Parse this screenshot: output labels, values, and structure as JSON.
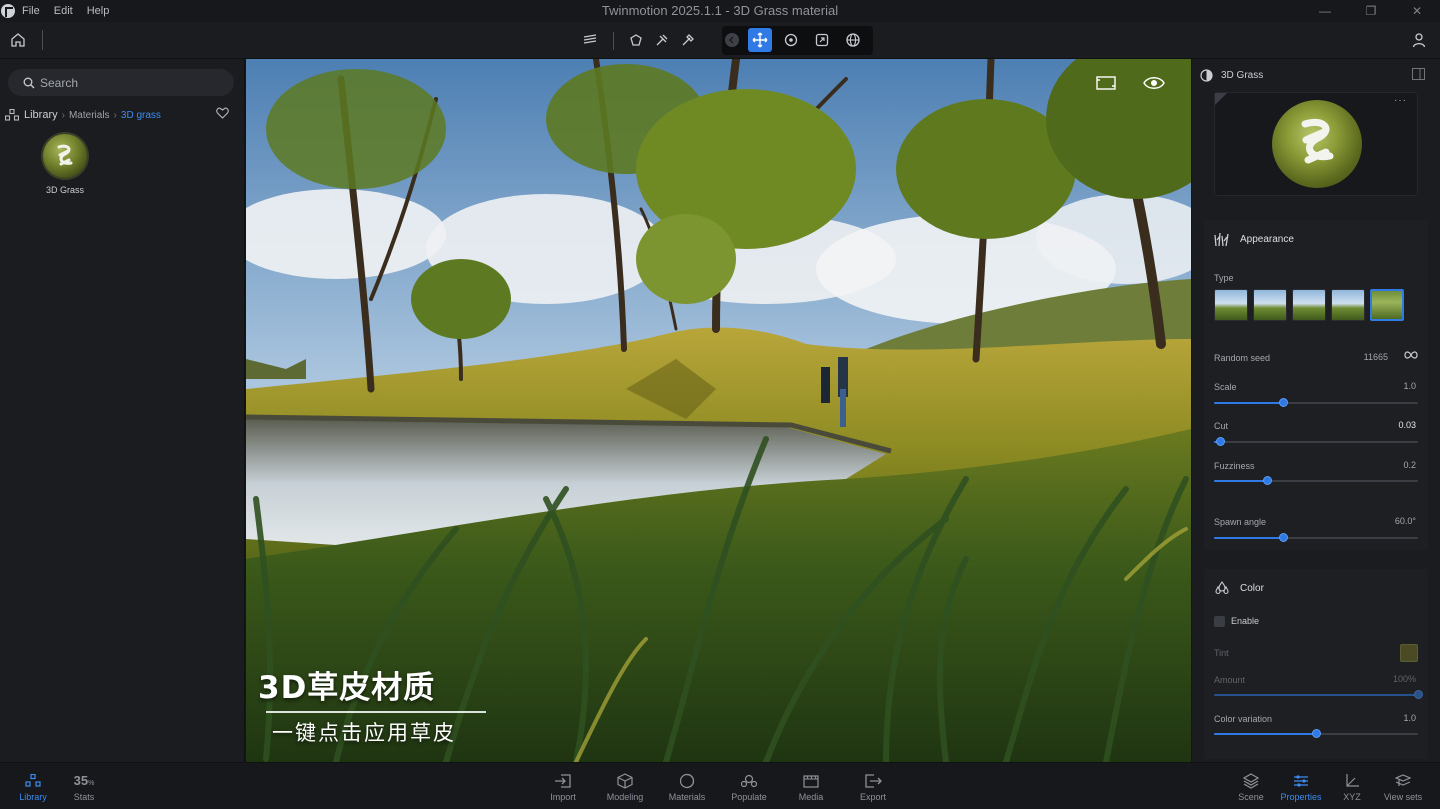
{
  "window": {
    "title": "Twinmotion 2025.1.1 - 3D Grass material",
    "menu": [
      "File",
      "Edit",
      "Help"
    ],
    "controls": [
      "minimize",
      "restore",
      "close"
    ]
  },
  "toolbar": {
    "icons": [
      "home-icon",
      "layers-icon",
      "select-shape-icon",
      "paint-brush-icon",
      "eyedropper-icon",
      "back-icon",
      "move-icon",
      "orbit-icon",
      "fit-icon",
      "globe-icon",
      "user-icon"
    ],
    "active_tool": "move"
  },
  "library": {
    "search_placeholder": "Search",
    "breadcrumb": [
      "Library",
      "Materials",
      "3D grass"
    ],
    "assets": [
      {
        "label": "3D Grass"
      }
    ]
  },
  "viewport": {
    "caption_main": "3D草皮材质",
    "caption_sub": "一键点击应用草皮"
  },
  "properties": {
    "title": "3D Grass",
    "appearance": {
      "title": "Appearance",
      "type_label": "Type",
      "type_count": 5,
      "type_selected_index": 4,
      "random_seed_label": "Random seed",
      "random_seed_value": "11665",
      "scale_label": "Scale",
      "scale_value": "1.0",
      "scale_fraction": 0.34,
      "cut_label": "Cut",
      "cut_value": "0.03",
      "cut_fraction": 0.03,
      "fuzziness_label": "Fuzziness",
      "fuzziness_value": "0.2",
      "fuzziness_fraction": 0.26,
      "spawn_label": "Spawn angle",
      "spawn_value": "60.0°",
      "spawn_fraction": 0.34
    },
    "color": {
      "title": "Color",
      "enable_label": "Enable",
      "enabled": false,
      "tint_label": "Tint",
      "tint_color": "#4a4b25",
      "amount_label": "Amount",
      "amount_value": "100%",
      "amount_fraction": 1.0,
      "variation_label": "Color variation",
      "variation_value": "1.0",
      "variation_fraction": 0.5
    }
  },
  "bottom_bar": {
    "library_label": "Library",
    "stats_value": "35",
    "stats_unit": "%",
    "stats_label": "Stats",
    "center": [
      "Import",
      "Modeling",
      "Materials",
      "Populate",
      "Media",
      "Export"
    ],
    "right": [
      "Scene",
      "Properties",
      "XYZ",
      "View sets"
    ],
    "active_right": "Properties"
  },
  "colors": {
    "accent": "#2f7ae5",
    "panel": "#1b1c20",
    "background": "#151619"
  }
}
